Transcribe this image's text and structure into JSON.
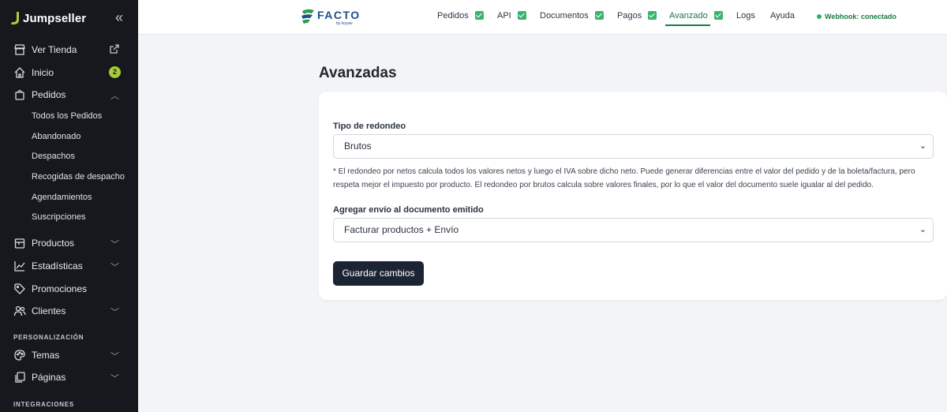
{
  "sidebar": {
    "brand": "Jumpseller",
    "collapse_glyph": "«",
    "items": [
      {
        "label": "Ver Tienda",
        "icon": "store-icon"
      },
      {
        "label": "Inicio",
        "icon": "home-icon",
        "badge": "2"
      },
      {
        "label": "Pedidos",
        "icon": "bag-icon"
      },
      {
        "label": "Productos",
        "icon": "box-icon"
      },
      {
        "label": "Estadísticas",
        "icon": "chart-icon"
      },
      {
        "label": "Promociones",
        "icon": "tag-icon"
      },
      {
        "label": "Clientes",
        "icon": "users-icon"
      },
      {
        "label": "Temas",
        "icon": "palette-icon"
      },
      {
        "label": "Páginas",
        "icon": "pages-icon"
      }
    ],
    "pedidos_sub": [
      "Todos los Pedidos",
      "Abandonado",
      "Despachos",
      "Recogidas de despacho",
      "Agendamientos",
      "Suscripciones"
    ],
    "sections": {
      "personalizacion": "PERSONALIZACIÓN",
      "integraciones": "INTEGRACIONES"
    }
  },
  "topbar": {
    "logo_text": "FACTO",
    "logo_sub": "by koywe",
    "tabs": [
      {
        "label": "Pedidos",
        "checked": true
      },
      {
        "label": "API",
        "checked": true
      },
      {
        "label": "Documentos",
        "checked": true
      },
      {
        "label": "Pagos",
        "checked": true
      },
      {
        "label": "Avanzado",
        "checked": true,
        "active": true
      },
      {
        "label": "Logs",
        "checked": false
      },
      {
        "label": "Ayuda",
        "checked": false
      }
    ],
    "webhook": "Webhook: conectado"
  },
  "main": {
    "title": "Avanzadas",
    "rounding_label": "Tipo de redondeo",
    "rounding_value": "Brutos",
    "note": "* El redondeo por netos calcula todos los valores netos y luego el IVA sobre dicho neto. Puede generar diferencias entre el valor del pedido y de la boleta/factura, pero respeta mejor el impuesto por producto. El redondeo por brutos calcula sobre valores finales, por lo que el valor del documento suele igualar al del pedido.",
    "shipping_label": "Agregar envío al documento emitido",
    "shipping_value": "Facturar productos + Envío",
    "save_label": "Guardar cambios"
  },
  "colors": {
    "sidebar_bg": "#16181d",
    "accent_green": "#1b7a43",
    "badge": "#a9cb3a",
    "button": "#1b2434"
  }
}
